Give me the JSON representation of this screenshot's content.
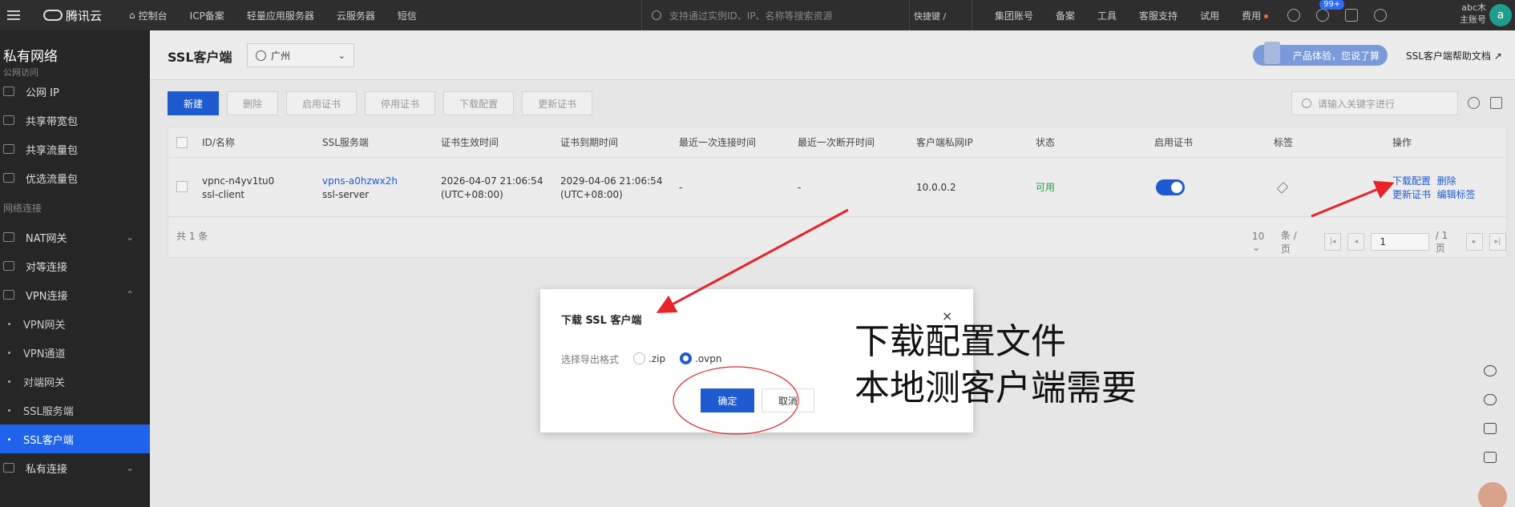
{
  "topbar": {
    "logo": "腾讯云",
    "nav": [
      "控制台",
      "ICP备案",
      "轻量应用服务器",
      "云服务器",
      "短信"
    ],
    "search_placeholder": "支持通过实例ID、IP、名称等搜索资源",
    "shortcut": "快捷键 /",
    "right_nav": [
      "集团账号",
      "备案",
      "工具",
      "客服支持",
      "试用",
      "费用"
    ],
    "badge": "99+",
    "account_name": "abc木",
    "account_role": "主账号",
    "avatar": "a"
  },
  "sidebar": {
    "title": "私有网络",
    "cut_label": "公网访问",
    "items_top": [
      "公网 IP",
      "共享带宽包",
      "共享流量包",
      "优选流量包"
    ],
    "group_label": "网络连接",
    "nat": "NAT网关",
    "peer": "对等连接",
    "vpn": "VPN连接",
    "vpn_sub": [
      "VPN网关",
      "VPN通道",
      "对端网关",
      "SSL服务端",
      "SSL客户端"
    ],
    "private_link": "私有连接"
  },
  "page": {
    "title": "SSL客户端",
    "region": "广州",
    "experience": "产品体验，您说了算",
    "help": "SSL客户端帮助文档"
  },
  "toolbar": {
    "buttons": [
      "新建",
      "删除",
      "启用证书",
      "停用证书",
      "下载配置",
      "更新证书"
    ],
    "search_placeholder": "请输入关键字进行"
  },
  "table": {
    "headers": [
      "ID/名称",
      "SSL服务端",
      "证书生效时间",
      "证书到期时间",
      "最近一次连接时间",
      "最近一次断开时间",
      "客户端私网IP",
      "状态",
      "启用证书",
      "标签",
      "操作"
    ],
    "row": {
      "id": "vpnc-n4yv1tu0",
      "name": "ssl-client",
      "server_id": "vpns-a0hzwx2h",
      "server_name": "ssl-server",
      "start_time": "2026-04-07 21:06:54",
      "start_tz": "(UTC+08:00)",
      "end_time": "2029-04-06 21:06:54",
      "end_tz": "(UTC+08:00)",
      "last_connect": "-",
      "last_disconnect": "-",
      "private_ip": "10.0.0.2",
      "status": "可用",
      "cert_enabled": true,
      "actions": [
        "下载配置",
        "删除",
        "更新证书",
        "编辑标签"
      ]
    },
    "total": "共 1 条",
    "page_size": "10",
    "per_page": "条 / 页",
    "page_num": "1",
    "page_total": "/ 1 页"
  },
  "dialog": {
    "title": "下载 SSL 客户端",
    "close": "×",
    "label": "选择导出格式",
    "options": [
      ".zip",
      ".ovpn"
    ],
    "selected": ".ovpn",
    "ok": "确定",
    "cancel": "取消"
  },
  "annotation": {
    "line1": "下载配置文件",
    "line2": "本地测客户端需要",
    "color": "#e8232a"
  }
}
